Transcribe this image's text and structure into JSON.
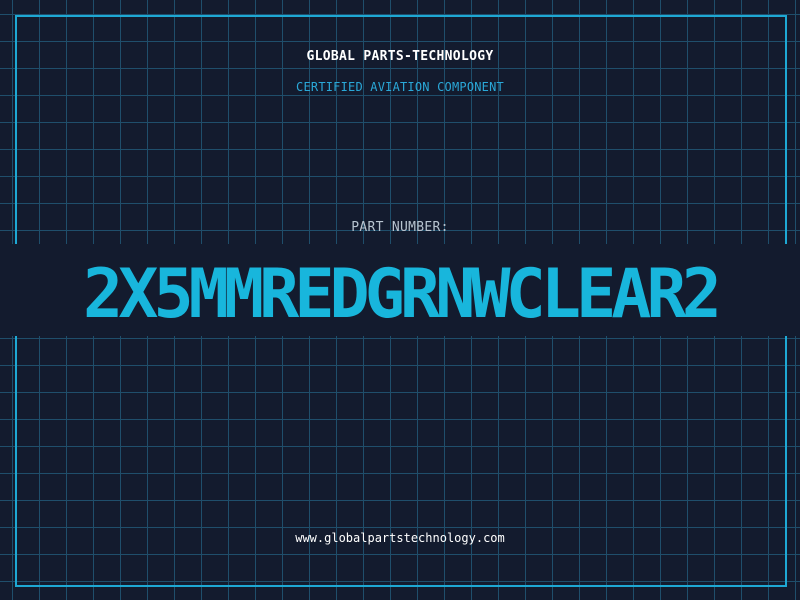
{
  "header": {
    "company": "GLOBAL PARTS-TECHNOLOGY",
    "subtitle": "CERTIFIED AVIATION COMPONENT"
  },
  "part": {
    "label": "PART NUMBER:",
    "number": "2X5MMREDGRNWCLEAR2"
  },
  "footer": {
    "website": "www.globalpartstechnology.com"
  },
  "colors": {
    "background": "#131b2e",
    "grid": "#1f4e6b",
    "frame": "#1ea8d4",
    "accent": "#18b6dc",
    "text": "#ffffff"
  }
}
